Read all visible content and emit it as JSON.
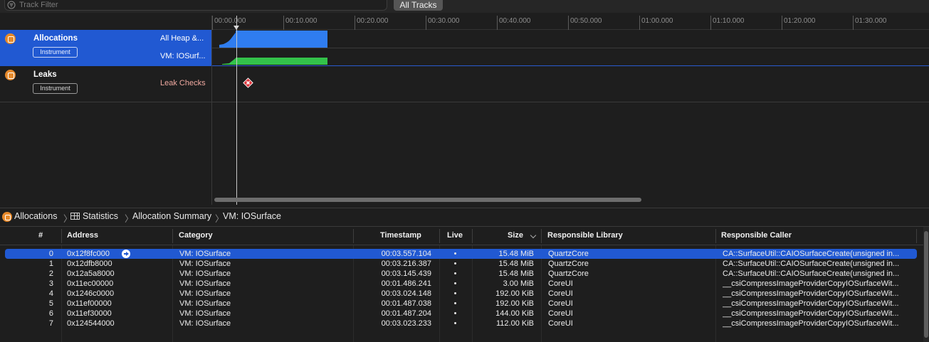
{
  "filter": {
    "placeholder": "Track Filter",
    "all_tracks_label": "All Tracks"
  },
  "tracks": [
    {
      "name": "Allocations",
      "badge": "Instrument",
      "labels": [
        "All Heap &...",
        "VM: IOSurf..."
      ],
      "icon": "allocations-icon",
      "selected": true
    },
    {
      "name": "Leaks",
      "badge": "Instrument",
      "labels": [
        "Leak Checks"
      ],
      "icon": "leaks-icon",
      "selected": false
    }
  ],
  "timeline": {
    "ticks": [
      "00:00.000",
      "00:10.000",
      "00:20.000",
      "00:30.000",
      "00:40.000",
      "00:50.000",
      "01:00.000",
      "01:10.000",
      "01:20.000",
      "01:30.000"
    ],
    "playhead_time": "00:00.000",
    "colors": {
      "heap": "#2f7df0",
      "vm": "#33c24a",
      "leak_marker": "#e0383e"
    }
  },
  "breadcrumb": {
    "items": [
      "Allocations",
      "Statistics",
      "Allocation Summary",
      "VM: IOSurface"
    ]
  },
  "table": {
    "columns": [
      "#",
      "Address",
      "Category",
      "Timestamp",
      "Live",
      "Size",
      "Responsible Library",
      "Responsible Caller"
    ],
    "sort_column": "Size",
    "rows": [
      {
        "idx": "0",
        "address": "0x12f8fc000",
        "category": "VM: IOSurface",
        "timestamp": "00:03.557.104",
        "live": "•",
        "size": "15.48 MiB",
        "library": "QuartzCore",
        "caller": "CA::SurfaceUtil::CAIOSurfaceCreate(unsigned in..."
      },
      {
        "idx": "1",
        "address": "0x12dfb8000",
        "category": "VM: IOSurface",
        "timestamp": "00:03.216.387",
        "live": "•",
        "size": "15.48 MiB",
        "library": "QuartzCore",
        "caller": "CA::SurfaceUtil::CAIOSurfaceCreate(unsigned in..."
      },
      {
        "idx": "2",
        "address": "0x12a5a8000",
        "category": "VM: IOSurface",
        "timestamp": "00:03.145.439",
        "live": "•",
        "size": "15.48 MiB",
        "library": "QuartzCore",
        "caller": "CA::SurfaceUtil::CAIOSurfaceCreate(unsigned in..."
      },
      {
        "idx": "3",
        "address": "0x11ec00000",
        "category": "VM: IOSurface",
        "timestamp": "00:01.486.241",
        "live": "•",
        "size": "3.00 MiB",
        "library": "CoreUI",
        "caller": "__csiCompressImageProviderCopyIOSurfaceWit..."
      },
      {
        "idx": "4",
        "address": "0x1246c0000",
        "category": "VM: IOSurface",
        "timestamp": "00:03.024.148",
        "live": "•",
        "size": "192.00 KiB",
        "library": "CoreUI",
        "caller": "__csiCompressImageProviderCopyIOSurfaceWit..."
      },
      {
        "idx": "5",
        "address": "0x11ef00000",
        "category": "VM: IOSurface",
        "timestamp": "00:01.487.038",
        "live": "•",
        "size": "192.00 KiB",
        "library": "CoreUI",
        "caller": "__csiCompressImageProviderCopyIOSurfaceWit..."
      },
      {
        "idx": "6",
        "address": "0x11ef30000",
        "category": "VM: IOSurface",
        "timestamp": "00:01.487.204",
        "live": "•",
        "size": "144.00 KiB",
        "library": "CoreUI",
        "caller": "__csiCompressImageProviderCopyIOSurfaceWit..."
      },
      {
        "idx": "7",
        "address": "0x124544000",
        "category": "VM: IOSurface",
        "timestamp": "00:03.023.233",
        "live": "•",
        "size": "112.00 KiB",
        "library": "CoreUI",
        "caller": "__csiCompressImageProviderCopyIOSurfaceWit..."
      }
    ],
    "selected_row": 0
  }
}
